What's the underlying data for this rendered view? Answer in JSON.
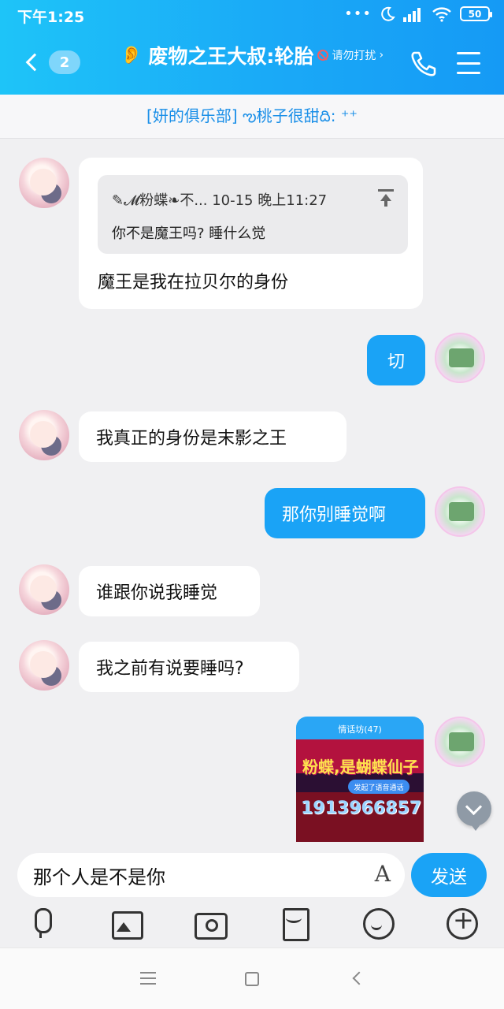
{
  "status_bar": {
    "time": "下午1:25",
    "dots": "•••",
    "battery": "50"
  },
  "header": {
    "unread_count": "2",
    "title": "废物之王大叔:轮胎",
    "subtitle": "请勿打扰",
    "subtitle_chevron": "›",
    "ear_icon": "👂"
  },
  "group_banner": {
    "text": "[妍的俱乐部] ఌ桃子很甜ది: ⁺⁺"
  },
  "messages": [
    {
      "sender": "other",
      "reply": {
        "meta": "✎𝓜粉蝶❧不... 10-15 晚上11:27",
        "text": "你不是魔王吗? 睡什么觉"
      },
      "text": "魔王是我在拉贝尔的身份"
    },
    {
      "sender": "me",
      "text": "切"
    },
    {
      "sender": "other",
      "text": "我真正的身份是末影之王"
    },
    {
      "sender": "me",
      "text": "那你别睡觉啊"
    },
    {
      "sender": "other",
      "text": "谁跟你说我睡觉"
    },
    {
      "sender": "other",
      "text": "我之前有说要睡吗?"
    },
    {
      "sender": "me",
      "image": {
        "title": "情话坊(47)",
        "overlay_text": "粉蝶,是蝴蝶仙子",
        "call_text": "发起了语音通话",
        "number_text": "1913966857"
      }
    }
  ],
  "input": {
    "value": "那个人是不是你",
    "font_icon": "A",
    "send_label": "发送"
  },
  "colors": {
    "accent": "#1aa3f6",
    "header_start": "#1ec4f8",
    "header_end": "#159af5",
    "bubble_other": "#ffffff",
    "background": "#f0f0f2"
  }
}
